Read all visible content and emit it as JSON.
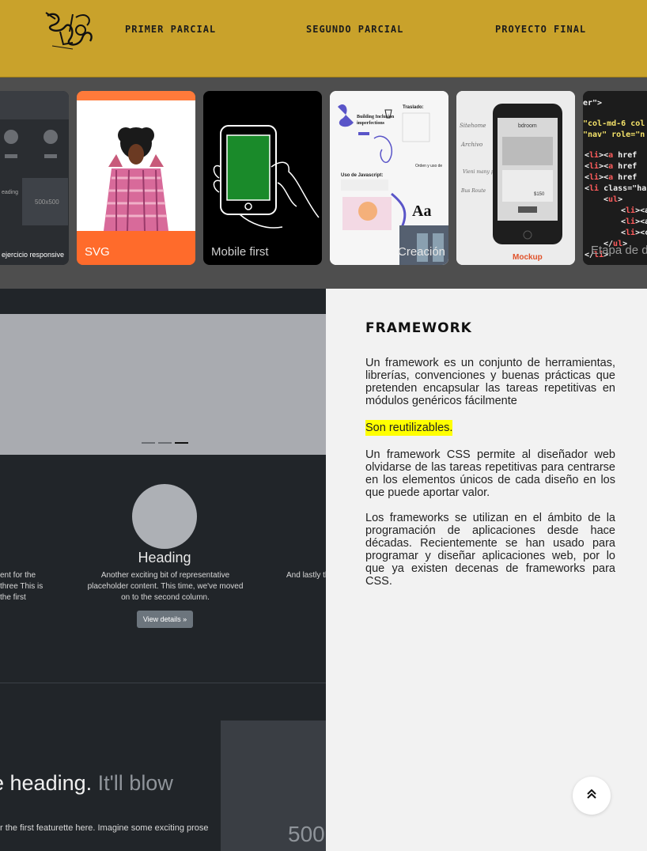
{
  "nav": {
    "items": [
      {
        "label": "PRIMER PARCIAL"
      },
      {
        "label": "SEGUNDO PARCIAL"
      },
      {
        "label": "PROYECTO FINAL"
      }
    ]
  },
  "gallery": {
    "cards": [
      {
        "label": "ejercicio responsive",
        "background": "#2a2a2a"
      },
      {
        "label": "SVG",
        "background": "#ff6b2b"
      },
      {
        "label": "Mobile first",
        "background": "#000000"
      },
      {
        "label": "Creación",
        "background": "#f4f4f4"
      },
      {
        "label": "Mockup",
        "background": "#e6e6e6"
      },
      {
        "label": "Etapa de desarrollo",
        "background": "#1e1e1e"
      }
    ]
  },
  "mockup": {
    "heading": "Heading",
    "col_left_text": "ent for the three This is the first",
    "col_center_text": "Another exciting bit of representative placeholder content. This time, we've moved on to the second column.",
    "col_right_text": "And lastly th",
    "button_label": "View details »",
    "feature_heading_main": "e heading.",
    "feature_heading_muted": "It'll blow",
    "feature_text": "r the first featurette here. Imagine some exciting prose",
    "feature_image_text": "500"
  },
  "article": {
    "title": "FRAMEWORK",
    "p1": "Un framework es un conjunto de herramientas, librerías, convenciones y buenas prácticas que pretenden encapsular las tareas repetitivas en módulos genéricos fácilmente",
    "highlight": "Son reutilizables.",
    "p2": "Un framework CSS permite al diseñador web olvidarse de las tareas repetitivas para centrarse en los elementos únicos de cada diseño en los que puede aportar valor.",
    "p3": "Los frameworks se utilizan en el ámbito de la programación de aplicaciones desde hace décadas. Recientemente se han usado para programar y diseñar aplicaciones web, por lo que ya existen decenas de frameworks para CSS."
  },
  "colors": {
    "header": "#c9a22b",
    "gallery": "#4e4e4e",
    "highlight": "#ffff00"
  }
}
